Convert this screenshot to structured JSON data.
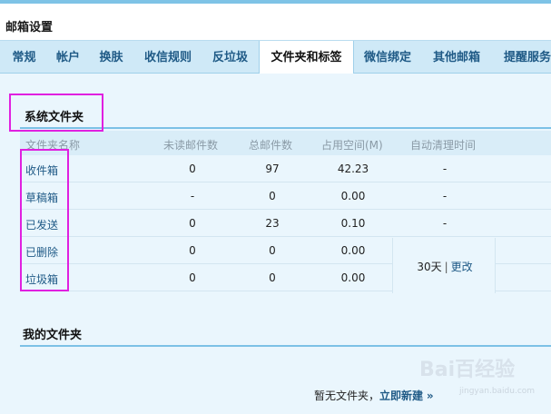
{
  "header": {
    "title": "邮箱设置"
  },
  "tabs": [
    {
      "label": "常规"
    },
    {
      "label": "帐户"
    },
    {
      "label": "换肤"
    },
    {
      "label": "收信规则"
    },
    {
      "label": "反垃圾"
    },
    {
      "label": "文件夹和标签",
      "active": true
    },
    {
      "label": "微信绑定"
    },
    {
      "label": "其他邮箱"
    },
    {
      "label": "提醒服务"
    }
  ],
  "system_folders": {
    "title": "系统文件夹",
    "columns": [
      "文件夹名称",
      "未读邮件数",
      "总邮件数",
      "占用空间(M)",
      "自动清理时间"
    ],
    "rows": [
      {
        "name": "收件箱",
        "unread": "0",
        "total": "97",
        "size": "42.23",
        "cleanup": "-"
      },
      {
        "name": "草稿箱",
        "unread": "-",
        "total": "0",
        "size": "0.00",
        "cleanup": "-"
      },
      {
        "name": "已发送",
        "unread": "0",
        "total": "23",
        "size": "0.10",
        "cleanup": "-"
      },
      {
        "name": "已删除",
        "unread": "0",
        "total": "0",
        "size": "0.00"
      },
      {
        "name": "垃圾箱",
        "unread": "0",
        "total": "0",
        "size": "0.00"
      }
    ],
    "merged_cleanup": {
      "days": "30天",
      "separator": "|",
      "edit": "更改"
    }
  },
  "my_folders": {
    "title": "我的文件夹",
    "empty_text": "暂无文件夹，",
    "new_link": "立即新建",
    "new_arrow": "»"
  },
  "watermark": {
    "text": "Bai百经验",
    "sub": "jingyan.baidu.com"
  },
  "colors": {
    "tab_bar": "#cfe9f7",
    "content_bg": "#eaf6fd",
    "link": "#1f5a86",
    "highlight": "#e020e0",
    "section_line": "#7cc1e6"
  }
}
